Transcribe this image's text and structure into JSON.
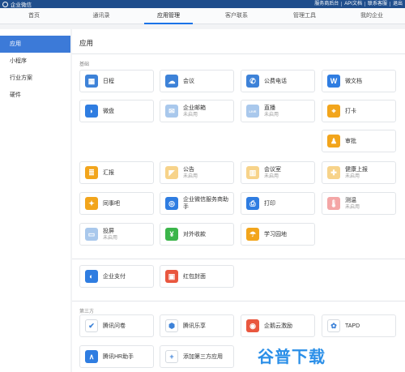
{
  "topbar": {
    "brand": "企业微信",
    "links": [
      "服务商后台",
      "API文档",
      "联系客服",
      "退出"
    ]
  },
  "tabs": [
    "首页",
    "通讯录",
    "应用管理",
    "客户联系",
    "管理工具",
    "我的企业"
  ],
  "active_tab": "应用管理",
  "sidebar": [
    "应用",
    "小程序",
    "行业方案",
    "硬件"
  ],
  "main": {
    "title": "应用",
    "section_basic": "基础",
    "section_third": "第三方"
  },
  "apps": [
    {
      "name": "日程",
      "status": "",
      "icon": "calendar-icon",
      "color": "#3d82d8",
      "glyph": "▦"
    },
    {
      "name": "会议",
      "status": "",
      "icon": "cloud-icon",
      "color": "#3d82d8",
      "glyph": "☁"
    },
    {
      "name": "公费电话",
      "status": "",
      "icon": "phone-icon",
      "color": "#3d82d8",
      "glyph": "✆"
    },
    {
      "name": "微文档",
      "status": "",
      "icon": "word-doc-icon",
      "color": "#2f7de1",
      "glyph": "W"
    },
    {
      "name": "微盘",
      "status": "",
      "icon": "drive-icon",
      "color": "#2f7de1",
      "glyph": "◗"
    },
    {
      "name": "企业邮箱",
      "status": "未启用",
      "icon": "mail-icon",
      "color": "#a9c8ec",
      "glyph": "✉"
    },
    {
      "name": "直播",
      "status": "未启用",
      "icon": "live-icon",
      "color": "#a9c8ec",
      "glyph": "LIVE"
    },
    {
      "name": "打卡",
      "status": "",
      "icon": "location-pin-icon",
      "color": "#f2a51c",
      "glyph": "⌖"
    },
    {
      "name": "审批",
      "status": "",
      "icon": "approval-stamp-icon",
      "color": "#f2a51c",
      "glyph": "♟"
    },
    {
      "name": "汇报",
      "status": "",
      "icon": "report-icon",
      "color": "#f2a51c",
      "glyph": "≣"
    },
    {
      "name": "公告",
      "status": "未启用",
      "icon": "megaphone-icon",
      "color": "#f7d38a",
      "glyph": "◤"
    },
    {
      "name": "会议室",
      "status": "未启用",
      "icon": "meeting-room-icon",
      "color": "#f7d38a",
      "glyph": "▥"
    },
    {
      "name": "健康上报",
      "status": "未启用",
      "icon": "health-report-icon",
      "color": "#f7d38a",
      "glyph": "✚"
    },
    {
      "name": "同事吧",
      "status": "",
      "icon": "colleague-icon",
      "color": "#f2a51c",
      "glyph": "✦"
    },
    {
      "name": "企业微信服务商助手",
      "status": "",
      "icon": "assistant-icon",
      "color": "#2f7de1",
      "glyph": "◎"
    },
    {
      "name": "打印",
      "status": "",
      "icon": "printer-icon",
      "color": "#2f7de1",
      "glyph": "⎙"
    },
    {
      "name": "测温",
      "status": "未启用",
      "icon": "thermometer-icon",
      "color": "#f4a6a6",
      "glyph": "🌡"
    },
    {
      "name": "投屏",
      "status": "未启用",
      "icon": "screen-cast-icon",
      "color": "#a9c8ec",
      "glyph": "▭"
    },
    {
      "name": "对外收款",
      "status": "",
      "icon": "payment-icon",
      "color": "#3bb54a",
      "glyph": "¥"
    },
    {
      "name": "学习园地",
      "status": "",
      "icon": "learning-icon",
      "color": "#f2a51c",
      "glyph": "☂"
    },
    {
      "name": "企业支付",
      "status": "",
      "icon": "enterprise-pay-icon",
      "color": "#2f7de1",
      "glyph": "◐"
    },
    {
      "name": "红包封面",
      "status": "",
      "icon": "red-packet-icon",
      "color": "#e9573f",
      "glyph": "▣"
    },
    {
      "name": "腾讯问卷",
      "status": "",
      "icon": "survey-icon",
      "color": "#ffffff",
      "glyph": "✔"
    },
    {
      "name": "腾讯乐享",
      "status": "",
      "icon": "lexiang-icon",
      "color": "#ffffff",
      "glyph": "⬢"
    },
    {
      "name": "企鹅云激励",
      "status": "",
      "icon": "penguin-incentive-icon",
      "color": "#e9573f",
      "glyph": "◉"
    },
    {
      "name": "TAPD",
      "status": "",
      "icon": "tapd-icon",
      "color": "#ffffff",
      "glyph": "✿"
    },
    {
      "name": "腾讯HR助手",
      "status": "",
      "icon": "hr-assistant-icon",
      "color": "#2f7de1",
      "glyph": "∧"
    },
    {
      "name": "添加第三方应用",
      "status": "",
      "icon": "plus-icon",
      "color": "#ffffff",
      "glyph": "+"
    }
  ],
  "watermark": "谷普下载"
}
